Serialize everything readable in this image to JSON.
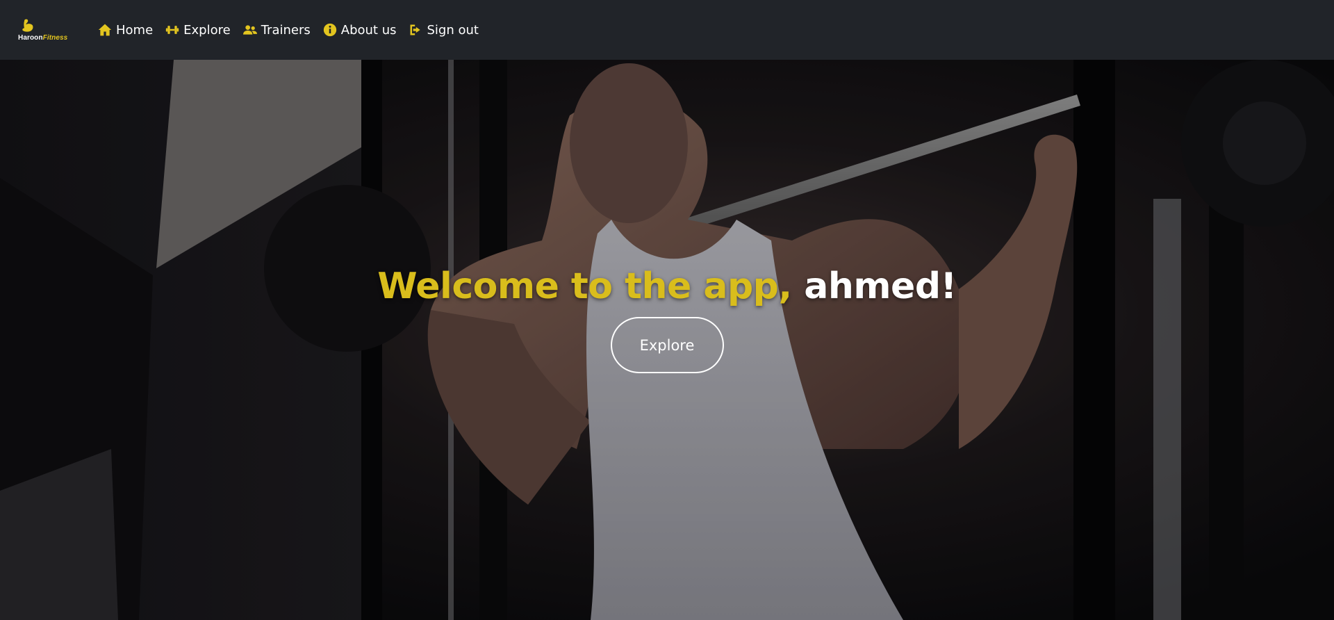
{
  "brand": {
    "name_part1": "Haroon",
    "name_part2": "Fitness",
    "logo_icon": "flexed-arm-icon"
  },
  "nav": {
    "items": [
      {
        "label": "Home",
        "icon": "home-icon"
      },
      {
        "label": "Explore",
        "icon": "dumbbell-icon"
      },
      {
        "label": "Trainers",
        "icon": "users-icon"
      },
      {
        "label": "About us",
        "icon": "info-circle-icon"
      },
      {
        "label": "Sign out",
        "icon": "sign-out-icon"
      }
    ]
  },
  "hero": {
    "welcome_prefix": "Welcome to the app,",
    "username": "ahmed!",
    "explore_button": "Explore"
  },
  "colors": {
    "navbar_bg": "#212429",
    "accent_yellow": "#e3c51f",
    "text_white": "#ffffff"
  }
}
